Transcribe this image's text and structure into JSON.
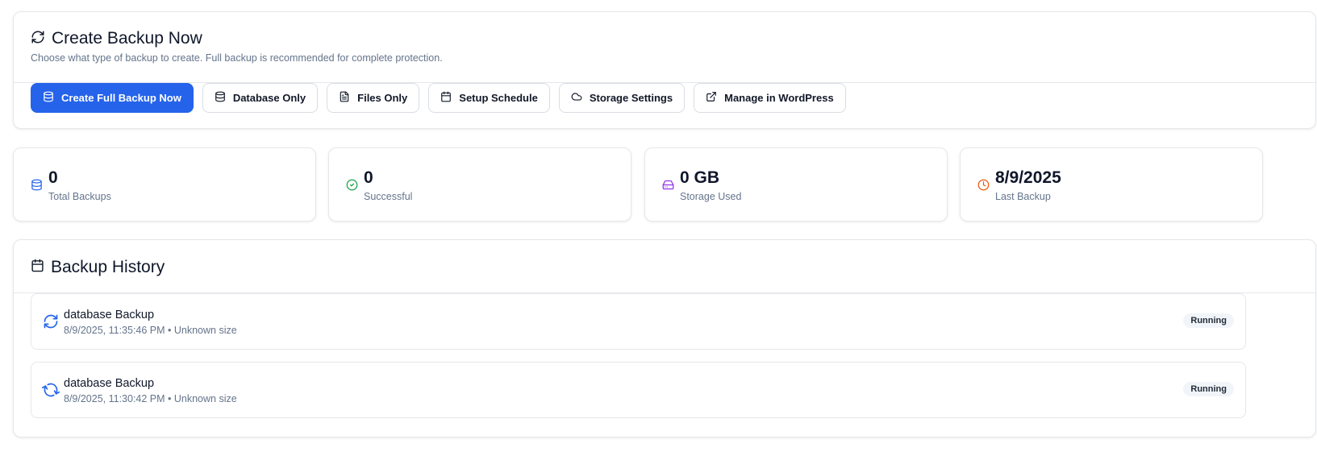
{
  "create": {
    "title": "Create Backup Now",
    "subtitle": "Choose what type of backup to create. Full backup is recommended for complete protection.",
    "buttons": {
      "full": "Create Full Backup Now",
      "database": "Database Only",
      "files": "Files Only",
      "schedule": "Setup Schedule",
      "storage": "Storage Settings",
      "wordpress": "Manage in WordPress"
    }
  },
  "stats": [
    {
      "value": "0",
      "label": "Total Backups",
      "icon": "database-icon",
      "color": "#2563eb"
    },
    {
      "value": "0",
      "label": "Successful",
      "icon": "check-circle-icon",
      "color": "#16a34a"
    },
    {
      "value": "0 GB",
      "label": "Storage Used",
      "icon": "hard-drive-icon",
      "color": "#9333ea"
    },
    {
      "value": "8/9/2025",
      "label": "Last Backup",
      "icon": "clock-icon",
      "color": "#ea580c"
    }
  ],
  "history": {
    "title": "Backup History",
    "items": [
      {
        "title": "database Backup",
        "meta": "8/9/2025, 11:35:46 PM • Unknown size",
        "status": "Running"
      },
      {
        "title": "database Backup",
        "meta": "8/9/2025, 11:30:42 PM • Unknown size",
        "status": "Running"
      }
    ]
  },
  "colors": {
    "primary": "#2563eb",
    "running_icon": "#2563eb"
  }
}
